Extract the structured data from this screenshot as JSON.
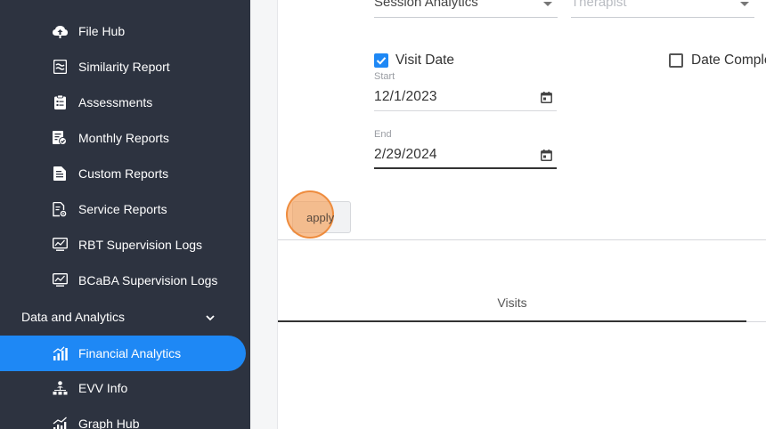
{
  "sidebar": {
    "top_label": "",
    "items": [
      {
        "label": "File Hub",
        "icon": "cloud-upload-icon"
      },
      {
        "label": "Similarity Report",
        "icon": "waves-icon"
      },
      {
        "label": "Assessments",
        "icon": "clipboard-list-icon"
      },
      {
        "label": "Monthly Reports",
        "icon": "report-check-icon"
      },
      {
        "label": "Custom Reports",
        "icon": "document-icon"
      },
      {
        "label": "Service Reports",
        "icon": "document-settings-icon"
      },
      {
        "label": "RBT Supervision Logs",
        "icon": "monitor-chart-icon"
      },
      {
        "label": "BCaBA Supervision Logs",
        "icon": "monitor-chart-icon"
      }
    ],
    "group": {
      "label": "Data and Analytics",
      "icon": "chevron-down-icon"
    },
    "group_items": [
      {
        "label": "Financial Analytics",
        "icon": "bar-chart-icon",
        "active": true
      },
      {
        "label": "EVV Info",
        "icon": "network-icon"
      },
      {
        "label": "Graph Hub",
        "icon": "line-chart-icon"
      }
    ]
  },
  "filters": {
    "report_type": "Session Analytics",
    "therapist_placeholder": "Therapist",
    "visit_date_label": "Visit Date",
    "visit_date_checked": true,
    "date_complete_label": "Date Comple",
    "date_complete_checked": false,
    "start_label": "Start",
    "start_value": "12/1/2023",
    "end_label": "End",
    "end_value": "2/29/2024",
    "apply_label": "apply"
  },
  "tabs": [
    {
      "label": "Visits",
      "active": true
    }
  ],
  "colors": {
    "sidebar_bg": "#2d3340",
    "accent": "#1e88f5"
  }
}
